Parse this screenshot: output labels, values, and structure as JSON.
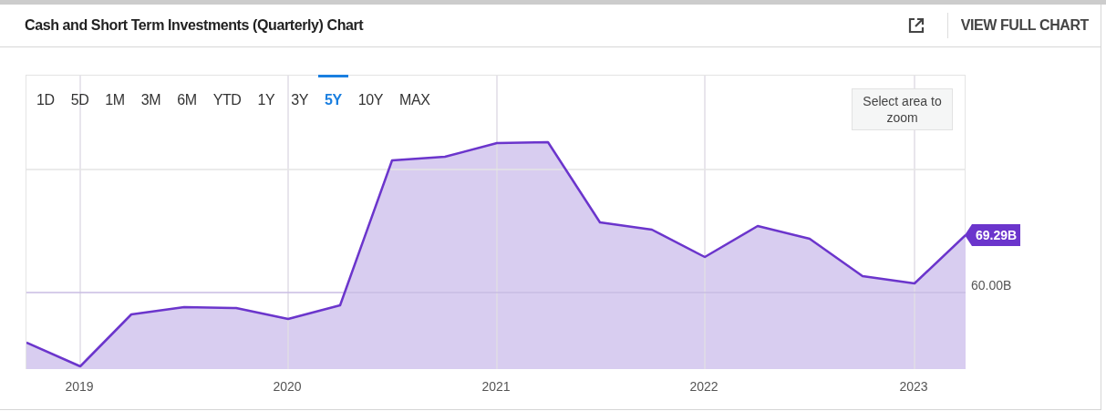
{
  "header": {
    "title": "Cash and Short Term Investments (Quarterly) Chart",
    "link": "VIEW FULL CHART"
  },
  "ranges": [
    {
      "label": "1D",
      "selected": false
    },
    {
      "label": "5D",
      "selected": false
    },
    {
      "label": "1M",
      "selected": false
    },
    {
      "label": "3M",
      "selected": false
    },
    {
      "label": "6M",
      "selected": false
    },
    {
      "label": "YTD",
      "selected": false
    },
    {
      "label": "1Y",
      "selected": false
    },
    {
      "label": "3Y",
      "selected": false
    },
    {
      "label": "5Y",
      "selected": true
    },
    {
      "label": "10Y",
      "selected": false
    },
    {
      "label": "MAX",
      "selected": false
    }
  ],
  "zoom_hint": "Select area to zoom",
  "chart": {
    "last_value": "69.29B",
    "y_label": "60.00B",
    "x_labels": [
      "2019",
      "2020",
      "2021",
      "2022",
      "2023"
    ]
  }
}
